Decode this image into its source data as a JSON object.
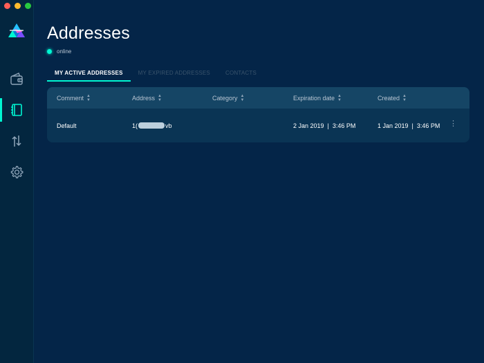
{
  "window": {
    "dots": [
      "#ff5f57",
      "#febc2e",
      "#28c840"
    ]
  },
  "sidebar": {
    "items": [
      {
        "name": "wallet",
        "icon": "wallet-icon"
      },
      {
        "name": "addresses",
        "icon": "addresses-icon",
        "active": true
      },
      {
        "name": "transactions",
        "icon": "transfer-icon"
      },
      {
        "name": "settings",
        "icon": "gear-icon"
      }
    ]
  },
  "page": {
    "title": "Addresses",
    "status": "online"
  },
  "tabs": [
    {
      "label": "MY ACTIVE ADDRESSES",
      "active": true
    },
    {
      "label": "MY EXPIRED ADDRESSES",
      "active": false
    },
    {
      "label": "CONTACTS",
      "active": false
    }
  ],
  "table": {
    "columns": [
      "Comment",
      "Address",
      "Category",
      "Expiration date",
      "Created"
    ],
    "rows": [
      {
        "comment": "Default",
        "address_start": "1(",
        "address_end": "vb",
        "category": "",
        "expiration": "2 Jan 2019  |  3:46 PM",
        "created": "1 Jan 2019  |  3:46 PM"
      }
    ]
  },
  "colors": {
    "background": "#042548",
    "sidebar": "#03263f",
    "accent": "#00f6d2",
    "table_header": "#154565",
    "table_body": "#0a3454"
  }
}
